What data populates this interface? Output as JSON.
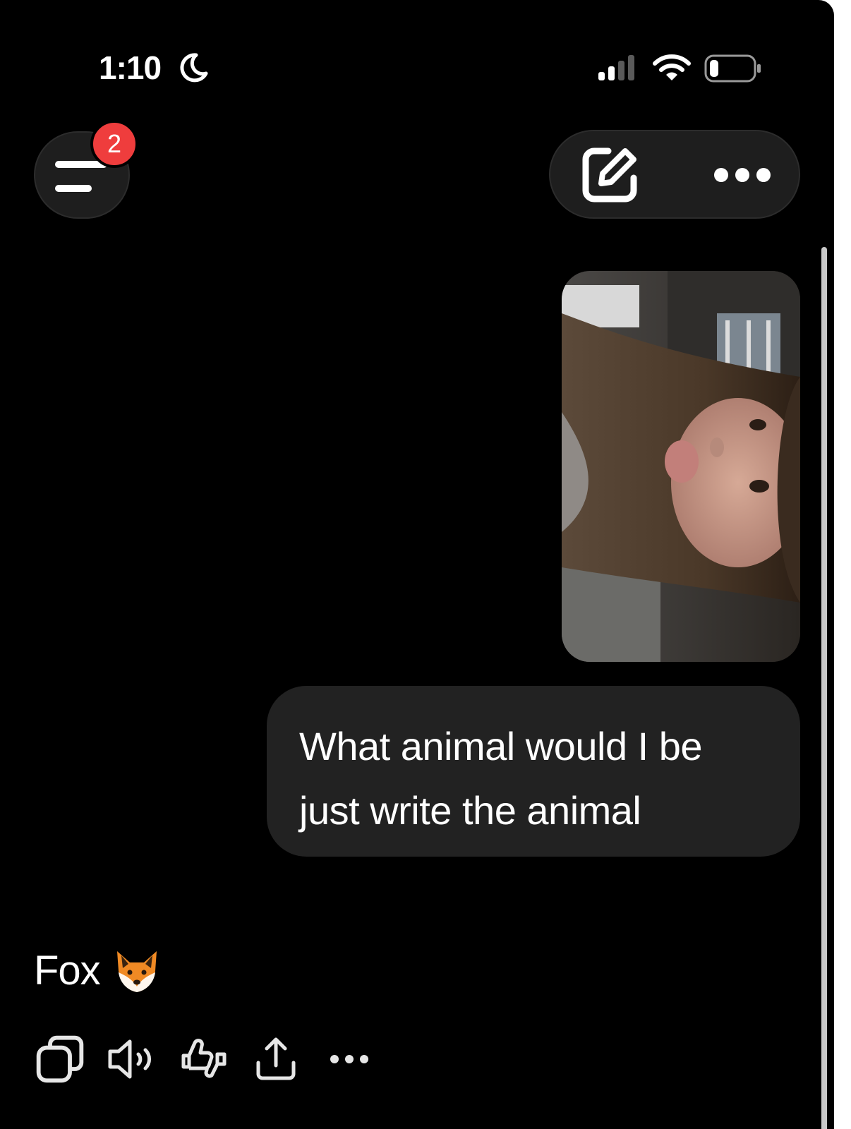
{
  "status_bar": {
    "time": "1:10",
    "focus_icon": "moon-icon",
    "signal_icon": "cellular-signal-icon",
    "wifi_icon": "wifi-icon",
    "battery_icon": "battery-low-icon",
    "battery_level": 0.15
  },
  "header": {
    "menu_icon": "sidebar-menu-icon",
    "notification_count": "2",
    "new_chat_icon": "edit-icon",
    "more_icon": "more-horizontal-icon"
  },
  "conversation": {
    "user_image": {
      "icon": "photo-thumbnail"
    },
    "user_message": "What animal would I be just write the animal",
    "assistant_reply": "Fox",
    "assistant_reply_emoji": "fox-face-emoji"
  },
  "response_actions": {
    "icons": [
      "copy-icon",
      "read-aloud-icon",
      "thumbs-feedback-icon",
      "share-icon",
      "more-horizontal-icon"
    ]
  },
  "colors": {
    "background": "#000000",
    "bubble": "#222222",
    "badge": "#ef3d3d",
    "pill": "#1e1e1e"
  }
}
